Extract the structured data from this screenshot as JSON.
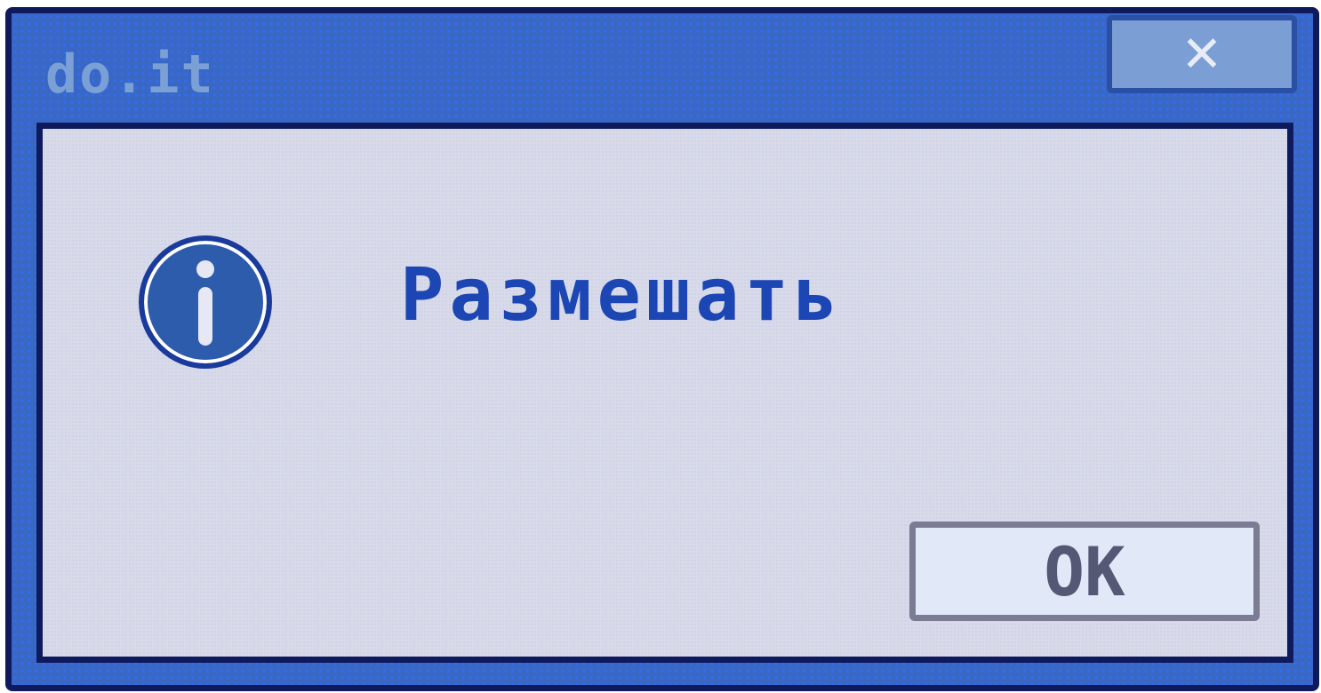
{
  "window": {
    "title": "do.it",
    "close_label": "✕"
  },
  "dialog": {
    "message": "Размешать",
    "icon": "info-icon",
    "ok_label": "OK"
  }
}
